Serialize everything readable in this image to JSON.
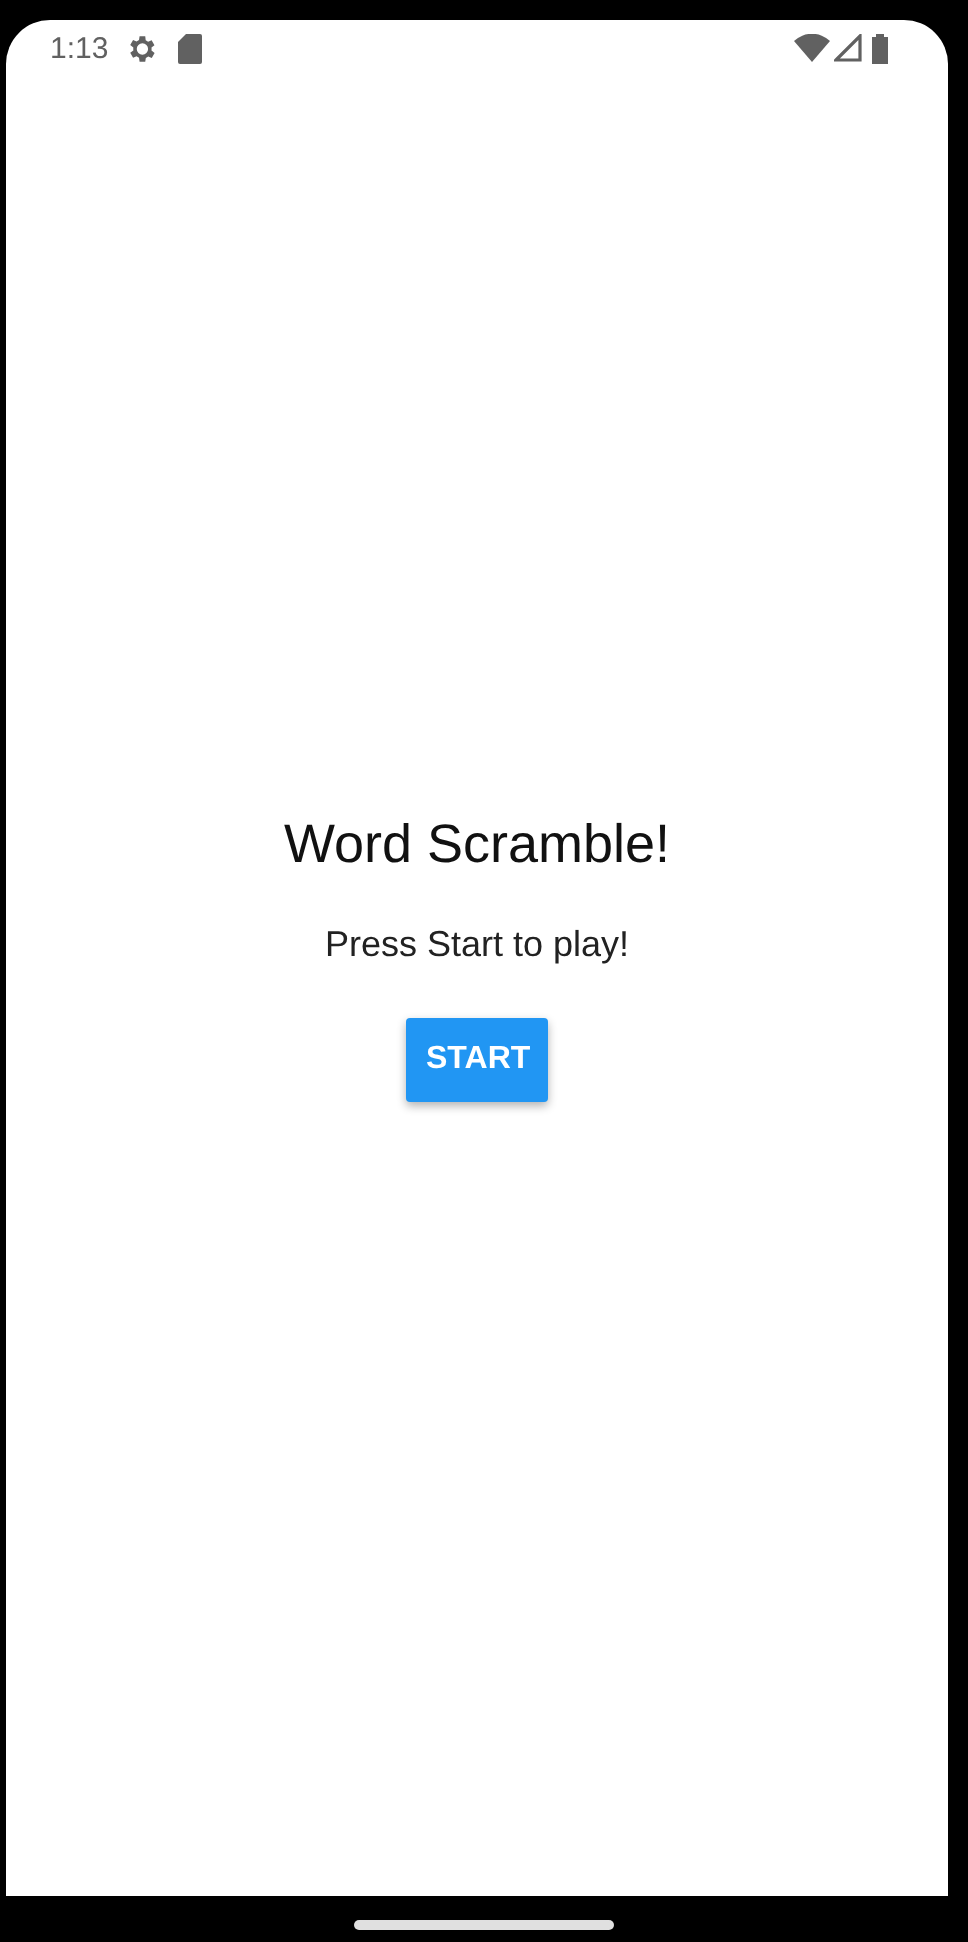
{
  "status_bar": {
    "time": "1:13"
  },
  "title": "Word Scramble!",
  "subtitle": "Press Start to play!",
  "start_button": {
    "label": "START"
  }
}
